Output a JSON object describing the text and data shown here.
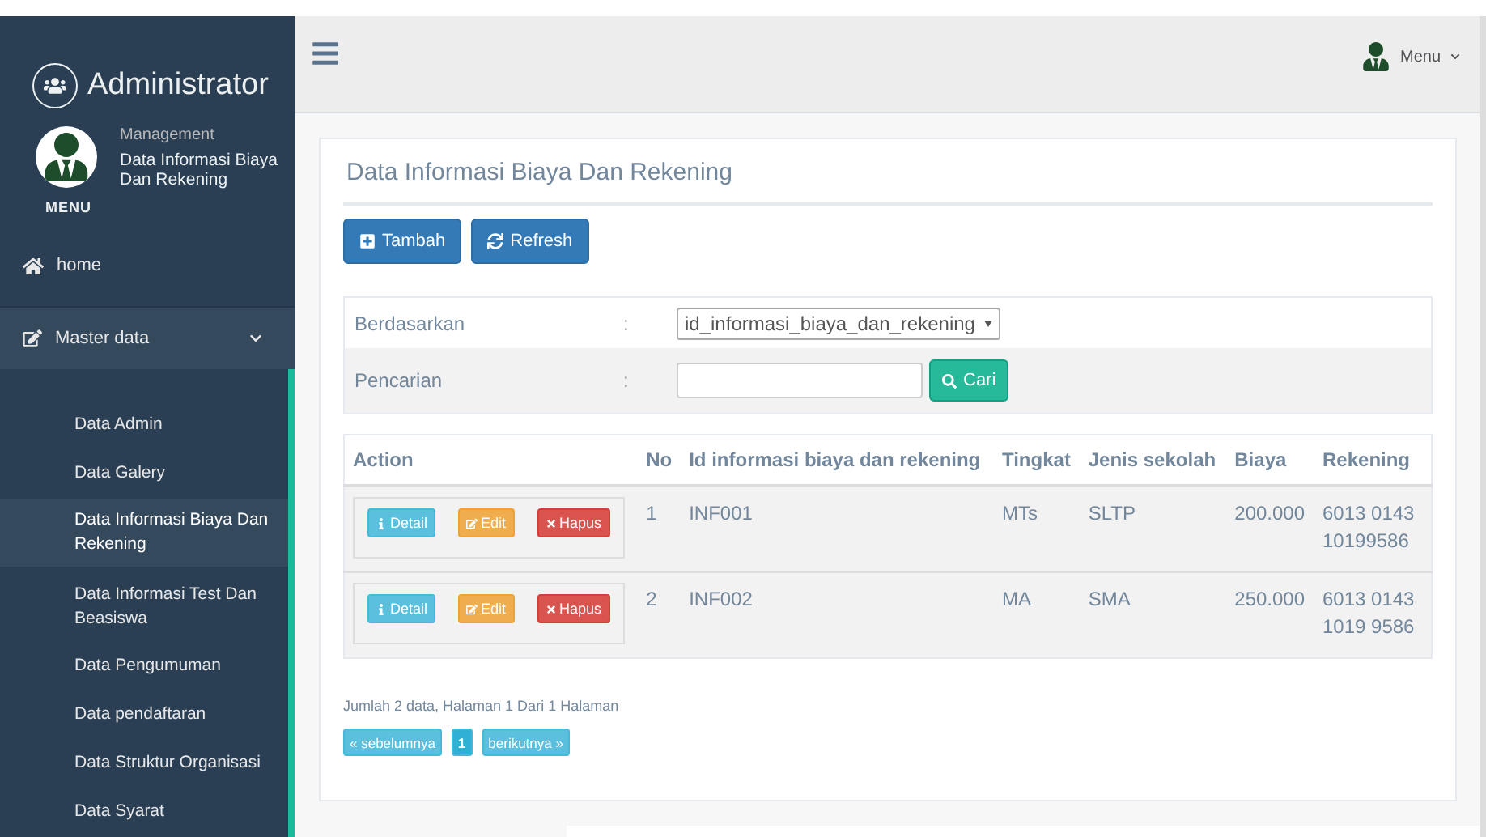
{
  "sidebar": {
    "title": "Administrator",
    "profile": {
      "role": "Management",
      "page": "Data Informasi Biaya Dan Rekening"
    },
    "menu_label": "MENU",
    "items": [
      {
        "label": "home",
        "kind": "home",
        "expanded": false
      },
      {
        "label": "Master data",
        "kind": "folder",
        "expanded": true,
        "children": [
          {
            "label": "Data Admin",
            "selected": false
          },
          {
            "label": "Data Galery",
            "selected": false
          },
          {
            "label": "Data Informasi Biaya Dan Rekening",
            "selected": true
          },
          {
            "label": "Data Informasi Test Dan Beasiswa",
            "selected": false
          },
          {
            "label": "Data Pengumuman",
            "selected": false
          },
          {
            "label": "Data pendaftaran",
            "selected": false
          },
          {
            "label": "Data Struktur Organisasi",
            "selected": false
          },
          {
            "label": "Data Syarat",
            "selected": false
          }
        ]
      }
    ]
  },
  "topbar": {
    "user_menu": "Menu"
  },
  "panel": {
    "title": "Data Informasi Biaya Dan Rekening",
    "buttons": [
      {
        "label": "Tambah",
        "kind": "add"
      },
      {
        "label": "Refresh",
        "kind": "refresh"
      }
    ],
    "filter": {
      "by_label": "Berdasarkan",
      "separator": ":",
      "by_value": "id_informasi_biaya_dan_rekening",
      "search_label": "Pencarian",
      "search_separator": ":",
      "search_button": "Cari"
    },
    "table": {
      "columns": [
        "Action",
        "No",
        "Id informasi biaya dan rekening",
        "Tingkat",
        "Jenis sekolah",
        "Biaya",
        "Rekening"
      ],
      "rows": [
        {
          "cells": [
            [
              {
                "label": "Detail",
                "kind": "detail"
              },
              {
                "label": "Edit",
                "kind": "edit"
              },
              {
                "label": "Hapus",
                "kind": "delete"
              }
            ],
            "1",
            "INF001",
            "MTs",
            "SLTP",
            "200.000",
            "6013 0143 10199586"
          ]
        },
        {
          "cells": [
            [
              {
                "label": "Detail",
                "kind": "detail"
              },
              {
                "label": "Edit",
                "kind": "edit"
              },
              {
                "label": "Hapus",
                "kind": "delete"
              }
            ],
            "2",
            "INF002",
            "MA",
            "SMA",
            "250.000",
            "6013 0143 1019 9586"
          ]
        }
      ]
    },
    "summary": "Jumlah 2 data, Halaman 1 Dari 1 Halaman",
    "pagination": [
      {
        "label": "« sebelumnya",
        "selected": false
      },
      {
        "label": "1",
        "selected": true
      },
      {
        "label": "berikutnya »",
        "selected": false
      }
    ]
  }
}
